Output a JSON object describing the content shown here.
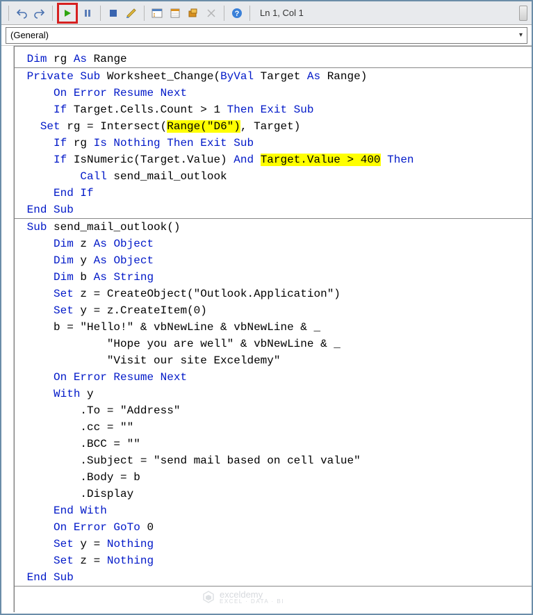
{
  "toolbar": {
    "undo_icon": "undo-icon",
    "redo_icon": "redo-icon",
    "run_icon": "play-icon",
    "break_icon": "pause-icon",
    "reset_icon": "stop-icon",
    "design_icon": "design-mode-icon",
    "project_icon": "project-explorer-icon",
    "properties_icon": "properties-icon",
    "browser_icon": "object-browser-icon",
    "toolbox_icon": "toolbox-icon",
    "help_icon": "help-icon",
    "status": "Ln 1, Col 1"
  },
  "dropdown": {
    "selected": "(General)"
  },
  "code": {
    "line1_kw1": "Dim",
    "line1_tx1": " rg ",
    "line1_kw2": "As",
    "line1_tx2": " Range",
    "line2_kw1": "Private Sub",
    "line2_tx1": " Worksheet_Change(",
    "line2_kw2": "ByVal",
    "line2_tx2": " Target ",
    "line2_kw3": "As",
    "line2_tx3": " Range)",
    "line3_kw1": "On Error Resume Next",
    "line4_kw1": "If",
    "line4_tx1": " Target.Cells.Count > 1 ",
    "line4_kw2": "Then Exit Sub",
    "line5_kw1": "Set",
    "line5_tx1": " rg = Intersect(",
    "line5_hl1": "Range(\"D6\")",
    "line5_tx2": ", Target)",
    "line6_kw1": "If",
    "line6_tx1": " rg ",
    "line6_kw2": "Is Nothing Then Exit Sub",
    "line7_kw1": "If",
    "line7_tx1": " IsNumeric(Target.Value) ",
    "line7_kw2": "And",
    "line7_sp": " ",
    "line7_hl1": "Target.Value > 400",
    "line7_sp2": " ",
    "line7_kw3": "Then",
    "line8_kw1": "Call",
    "line8_tx1": " send_mail_outlook",
    "line9_kw1": "End If",
    "line10_kw1": "End Sub",
    "line11_kw1": "Sub",
    "line11_tx1": " send_mail_outlook()",
    "line12_kw1": "Dim",
    "line12_tx1": " z ",
    "line12_kw2": "As Object",
    "line13_kw1": "Dim",
    "line13_tx1": " y ",
    "line13_kw2": "As Object",
    "line14_kw1": "Dim",
    "line14_tx1": " b ",
    "line14_kw2": "As String",
    "line15_kw1": "Set",
    "line15_tx1": " z = CreateObject(\"Outlook.Application\")",
    "line16_kw1": "Set",
    "line16_tx1": " y = z.CreateItem(0)",
    "line17_tx1": "    b = \"Hello!\" & vbNewLine & vbNewLine & _",
    "line18_tx1": "            \"Hope you are well\" & vbNewLine & _",
    "line19_tx1": "            \"Visit our site Exceldemy\"",
    "line20_kw1": "On Error Resume Next",
    "line21_kw1": "With",
    "line21_tx1": " y",
    "line22_tx1": "        .To = \"Address\"",
    "line23_tx1": "        .cc = \"\"",
    "line24_tx1": "        .BCC = \"\"",
    "line25_tx1": "        .Subject = \"send mail based on cell value\"",
    "line26_tx1": "        .Body = b",
    "line27_tx1": "        .Display",
    "line28_kw1": "End With",
    "line29_kw1": "On Error GoTo",
    "line29_tx1": " 0",
    "line30_kw1": "Set",
    "line30_tx1": " y = ",
    "line30_kw2": "Nothing",
    "line31_kw1": "Set",
    "line31_tx1": " z = ",
    "line31_kw2": "Nothing",
    "line32_kw1": "End Sub"
  },
  "watermark": {
    "brand": "exceldemy",
    "sub": "EXCEL · DATA · BI"
  }
}
